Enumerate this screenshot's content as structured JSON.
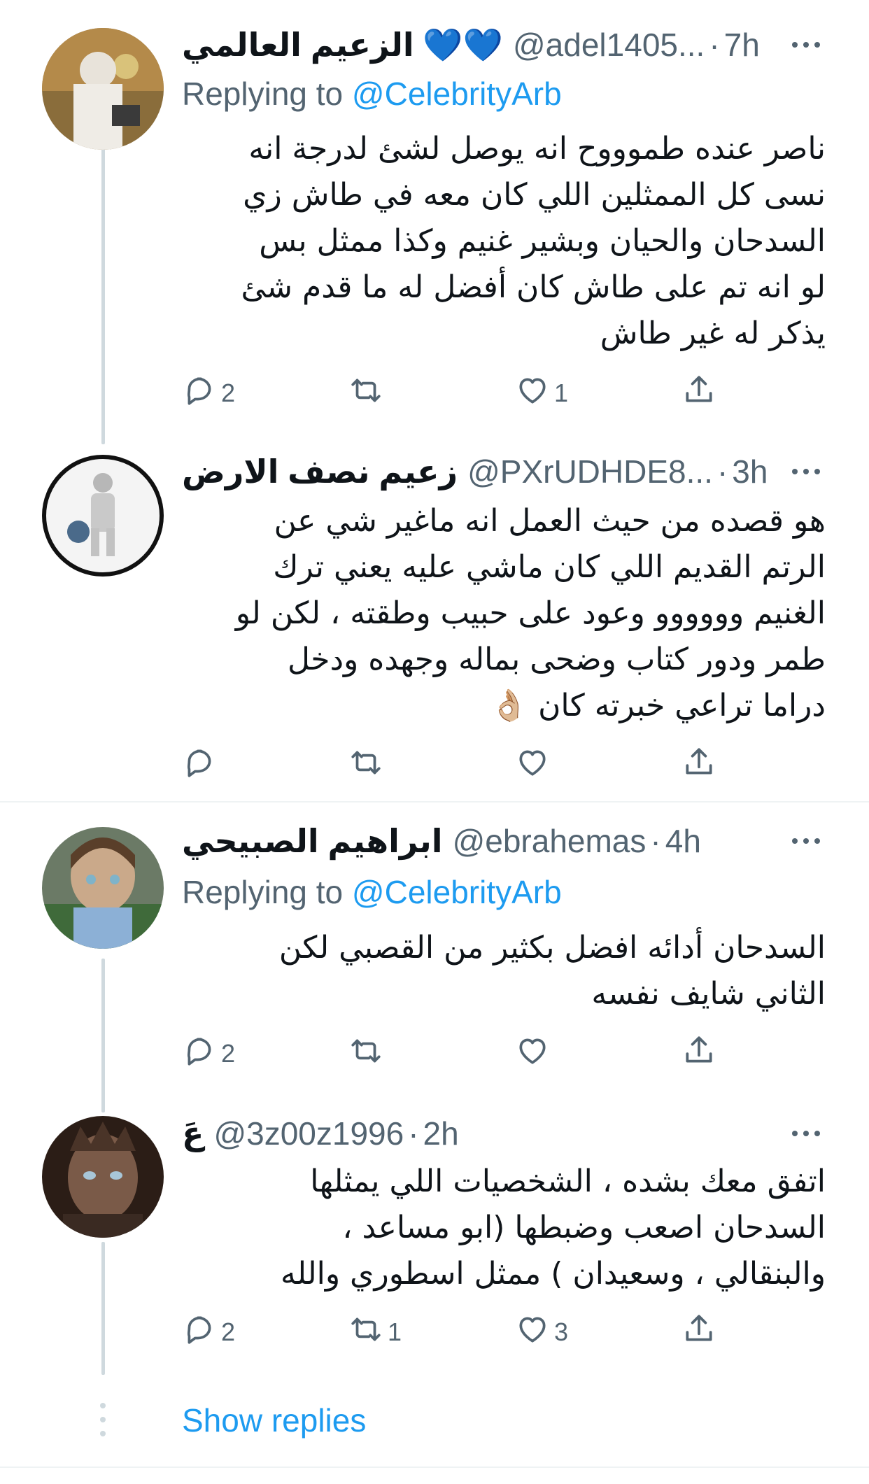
{
  "tweets": [
    {
      "name": "الزعيم العالمي 💙💙",
      "handle": "@adel1405...",
      "time": "7h",
      "replying_prefix": "Replying to ",
      "replying_to": "@CelebrityArb",
      "text": "ناصر عنده طموووح انه يوصل لشئ لدرجة انه\nنسى كل الممثلين اللي كان معه في طاش زي\nالسدحان والحيان وبشير غنيم وكذا ممثل بس\nلو انه تم على طاش كان أفضل له ما قدم شئ\nيذكر له غير طاش",
      "replies": "2",
      "retweets": "",
      "likes": "1"
    },
    {
      "name": "زعيم نصف الارض",
      "handle": "@PXrUDHDE8...",
      "time": "3h",
      "text": "هو قصده من حيث العمل انه ماغير شي عن\nالرتم القديم اللي كان ماشي عليه يعني ترك\nالغنيم وووووو   وعود على حبيب وطقته ، لكن لو\nطمر ودور كتاب وضحى بماله وجهده ودخل\nدراما تراعي خبرته كان 👌🏼",
      "replies": "",
      "retweets": "",
      "likes": ""
    },
    {
      "name": "ابراهيم الصبيحي",
      "handle": "@ebrahemas",
      "time": "4h",
      "replying_prefix": "Replying to ",
      "replying_to": "@CelebrityArb",
      "text": "السدحان أدائه افضل بكثير من القصبي لكن\nالثاني شايف نفسه",
      "replies": "2",
      "retweets": "",
      "likes": ""
    },
    {
      "name": "عَ",
      "handle": "@3z00z1996",
      "time": "2h",
      "text": "اتفق معك بشده ، الشخصيات اللي يمثلها\nالسدحان اصعب وضبطها (ابو مساعد ،\nوالبنقالي ، وسعيدان ) ممثل اسطوري والله",
      "replies": "2",
      "retweets": "1",
      "likes": "3"
    }
  ],
  "show_replies": "Show replies",
  "icons": {
    "reply": "reply-icon",
    "retweet": "retweet-icon",
    "like": "heart-icon",
    "share": "share-icon",
    "more": "more-icon"
  },
  "colors": {
    "accent": "#1d9bf0",
    "secondary_text": "#536471",
    "thread_line": "#cfd9de"
  }
}
